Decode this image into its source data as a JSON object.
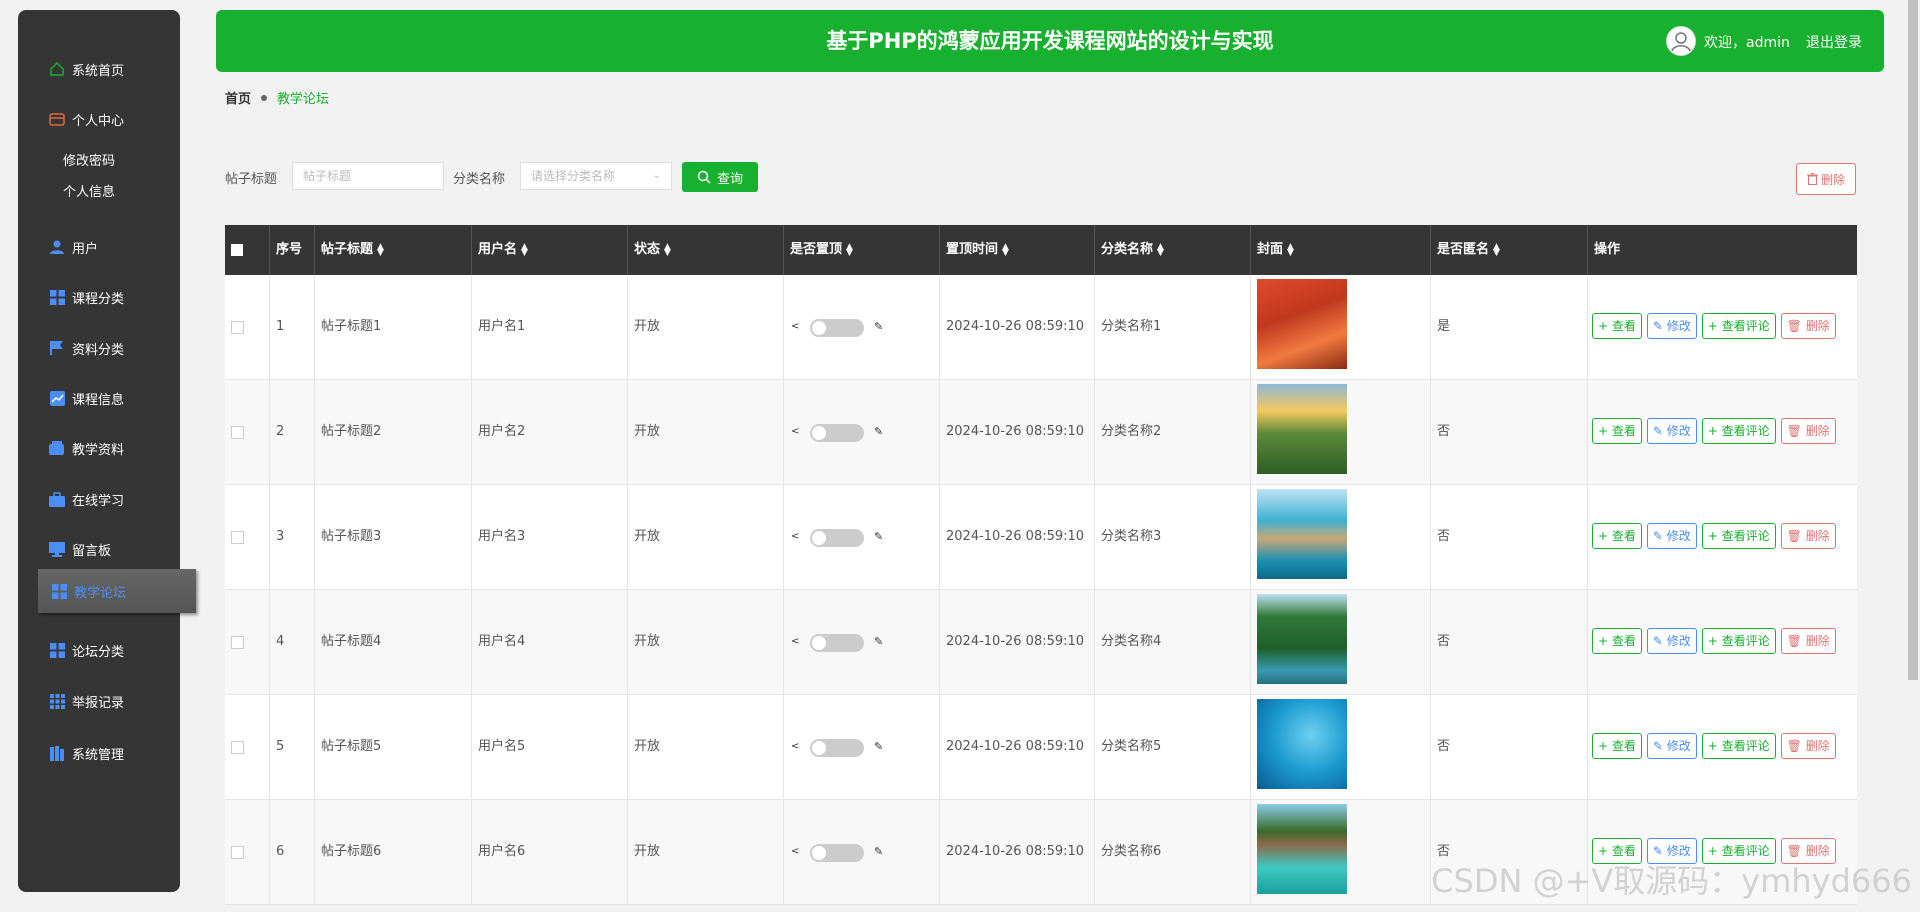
{
  "header": {
    "title": "基于PHP的鸿蒙应用开发课程网站的设计与实现",
    "welcome": "欢迎，admin",
    "logout": "退出登录"
  },
  "sidebar": {
    "items": [
      {
        "label": "系统首页",
        "icon": "home-icon"
      },
      {
        "label": "个人中心",
        "icon": "wallet-icon"
      },
      {
        "label": "用户",
        "icon": "user-icon"
      },
      {
        "label": "课程分类",
        "icon": "grid-icon"
      },
      {
        "label": "资料分类",
        "icon": "flag-icon"
      },
      {
        "label": "课程信息",
        "icon": "chart-icon"
      },
      {
        "label": "教学资料",
        "icon": "wallet-icon"
      },
      {
        "label": "在线学习",
        "icon": "briefcase-icon"
      },
      {
        "label": "留言板",
        "icon": "monitor-icon"
      },
      {
        "label": "教学论坛",
        "icon": "grid-icon"
      },
      {
        "label": "论坛分类",
        "icon": "grid-icon"
      },
      {
        "label": "举报记录",
        "icon": "apps-icon"
      },
      {
        "label": "系统管理",
        "icon": "books-icon"
      }
    ],
    "sub_items": [
      "修改密码",
      "个人信息"
    ],
    "active": "教学论坛"
  },
  "breadcrumb": {
    "home": "首页",
    "current": "教学论坛"
  },
  "search": {
    "title_label": "帖子标题",
    "title_placeholder": "帖子标题",
    "category_label": "分类名称",
    "category_placeholder": "请选择分类名称",
    "query_button": "查询",
    "delete_button": "删除"
  },
  "table": {
    "headers": [
      "序号",
      "帖子标题",
      "用户名",
      "状态",
      "是否置顶",
      "置顶时间",
      "分类名称",
      "封面",
      "是否匿名",
      "操作"
    ],
    "actions": {
      "view": "查看",
      "edit": "修改",
      "comments": "查看评论",
      "delete": "删除"
    },
    "rows": [
      {
        "index": "1",
        "title": "帖子标题1",
        "user": "用户名1",
        "status": "开放",
        "top": false,
        "time": "2024-10-26 08:59:10",
        "category": "分类名称1",
        "anon": "是",
        "cover": "autumn-path"
      },
      {
        "index": "2",
        "title": "帖子标题2",
        "user": "用户名2",
        "status": "开放",
        "top": false,
        "time": "2024-10-26 08:59:10",
        "category": "分类名称2",
        "anon": "否",
        "cover": "tea-field"
      },
      {
        "index": "3",
        "title": "帖子标题3",
        "user": "用户名3",
        "status": "开放",
        "top": false,
        "time": "2024-10-26 08:59:10",
        "category": "分类名称3",
        "anon": "否",
        "cover": "sea-rocks"
      },
      {
        "index": "4",
        "title": "帖子标题4",
        "user": "用户名4",
        "status": "开放",
        "top": false,
        "time": "2024-10-26 08:59:10",
        "category": "分类名称4",
        "anon": "否",
        "cover": "forest-river"
      },
      {
        "index": "5",
        "title": "帖子标题5",
        "user": "用户名5",
        "status": "开放",
        "top": false,
        "time": "2024-10-26 08:59:10",
        "category": "分类名称5",
        "anon": "否",
        "cover": "underwater"
      },
      {
        "index": "6",
        "title": "帖子标题6",
        "user": "用户名6",
        "status": "开放",
        "top": false,
        "time": "2024-10-26 08:59:10",
        "category": "分类名称6",
        "anon": "否",
        "cover": "beach-villas"
      }
    ]
  },
  "watermark": "CSDN @+V取源码：ymhyd666",
  "colors": {
    "primary": "#17b12f",
    "sidebar": "#353535",
    "edit": "#4b8ef5",
    "danger": "#e07474"
  }
}
